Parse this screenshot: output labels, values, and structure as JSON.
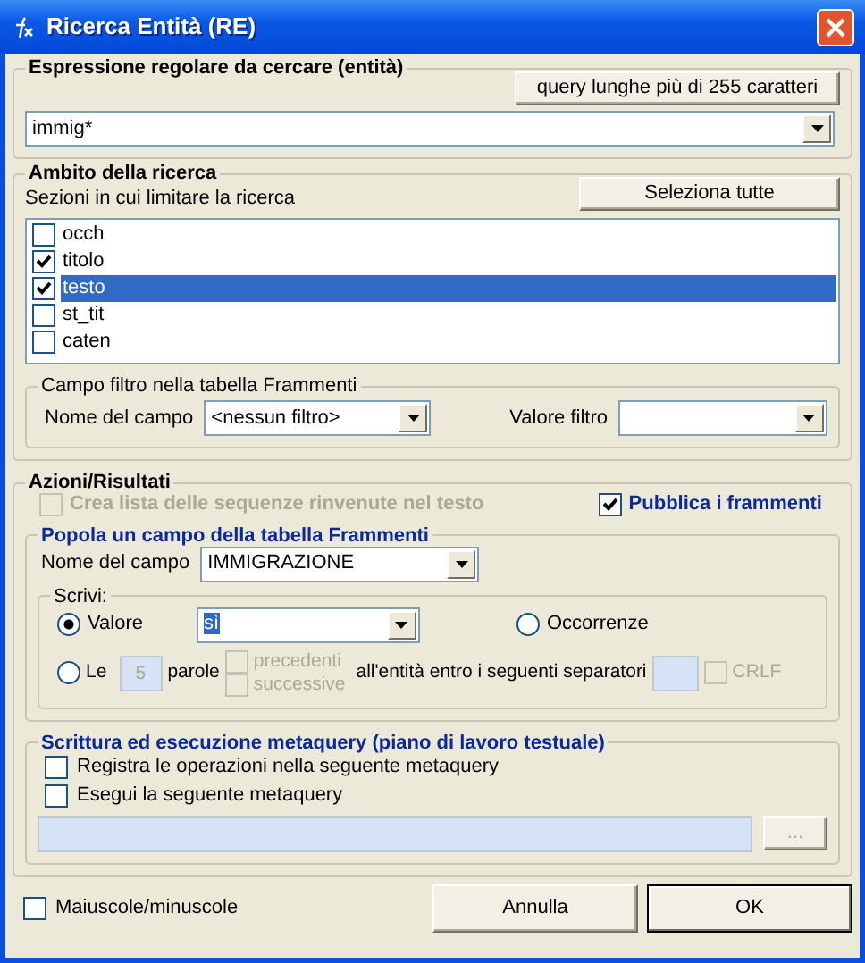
{
  "window": {
    "title": "Ricerca Entità (RE)"
  },
  "regex_group": {
    "legend": "Espressione regolare da cercare (entità)",
    "long_query_button": "query lunghe più di 255 caratteri",
    "expression": "immig*"
  },
  "scope_group": {
    "legend": "Ambito della ricerca",
    "hint": "Sezioni in cui limitare la ricerca",
    "select_all_button": "Seleziona tutte",
    "sections": [
      {
        "label": "occh",
        "checked": false,
        "selected": false
      },
      {
        "label": "titolo",
        "checked": true,
        "selected": false
      },
      {
        "label": "testo",
        "checked": true,
        "selected": true
      },
      {
        "label": "st_tit",
        "checked": false,
        "selected": false
      },
      {
        "label": "caten",
        "checked": false,
        "selected": false
      }
    ],
    "filter_group": {
      "legend": "Campo filtro nella tabella Frammenti",
      "field_label": "Nome del campo",
      "field_value": "<nessun filtro>",
      "value_label": "Valore filtro"
    }
  },
  "actions_group": {
    "legend": "Azioni/Risultati",
    "options": [
      {
        "label": "Crea lista delle sequenze rinvenute nel testo",
        "checked": false,
        "disabled": true
      },
      {
        "label": "Pubblica i frammenti",
        "checked": true,
        "disabled": false
      }
    ],
    "populate_group": {
      "legend": "Popola un campo della tabella Frammenti",
      "field_label": "Nome del campo",
      "field_value": "IMMIGRAZIONE",
      "write_group": {
        "legend": "Scrivi:",
        "modes": [
          {
            "label": "Valore",
            "selected": true
          },
          {
            "label": "Occorrenze",
            "selected": false
          },
          {
            "label": "Le",
            "selected": false
          }
        ],
        "value": "sì",
        "words_count": "5",
        "words_label": "parole",
        "directions": [
          {
            "label": "precedenti",
            "checked": false,
            "disabled": true
          },
          {
            "label": "successive",
            "checked": false,
            "disabled": true
          }
        ],
        "separators_label": "all'entità entro i seguenti separatori",
        "crlf": {
          "label": "CRLF",
          "checked": false,
          "disabled": true
        }
      }
    },
    "metaquery_group": {
      "legend": "Scrittura ed esecuzione metaquery (piano di lavoro testuale)",
      "options": [
        {
          "label": "Registra le operazioni nella seguente metaquery",
          "checked": false
        },
        {
          "label": "Esegui la seguente metaquery",
          "checked": false
        }
      ],
      "browse_button": "..."
    }
  },
  "footer": {
    "case_option": {
      "label": "Maiuscole/minuscole",
      "checked": false
    },
    "buttons": [
      "Annulla",
      "OK"
    ]
  }
}
